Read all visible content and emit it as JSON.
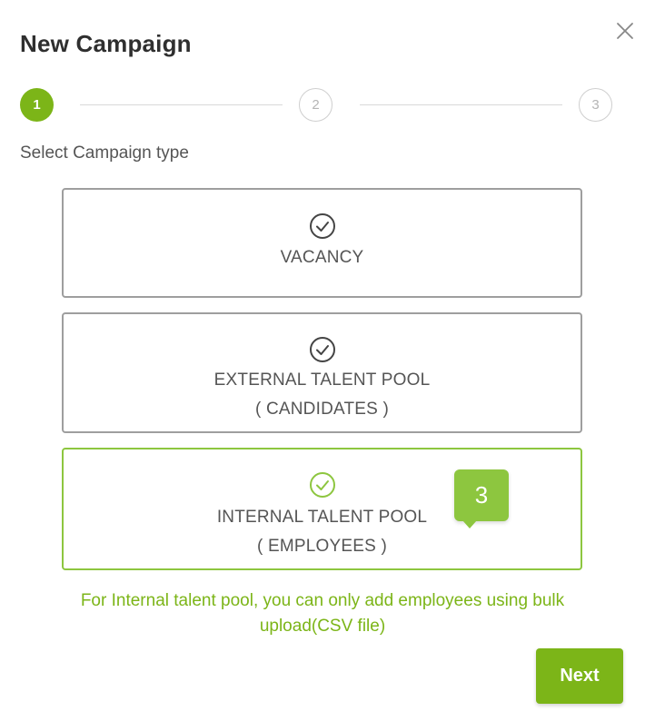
{
  "dialog": {
    "title": "New Campaign",
    "close_icon": "close-icon"
  },
  "stepper": {
    "steps": [
      {
        "label": "1",
        "state": "active"
      },
      {
        "label": "2",
        "state": "inactive"
      },
      {
        "label": "3",
        "state": "inactive"
      }
    ]
  },
  "subtitle": "Select Campaign type",
  "campaign_types": [
    {
      "line1": "VACANCY",
      "line2": "",
      "icon": "check-circle-icon",
      "selected": false
    },
    {
      "line1": "EXTERNAL TALENT POOL",
      "line2": "( CANDIDATES )",
      "icon": "check-circle-icon",
      "selected": false
    },
    {
      "line1": "INTERNAL TALENT POOL",
      "line2": "( EMPLOYEES )",
      "icon": "check-circle-icon",
      "selected": true
    }
  ],
  "badge": {
    "label": "3"
  },
  "note": "For Internal talent pool, you can only add employees using bulk upload(CSV file)",
  "next_button": {
    "label": "Next"
  },
  "colors": {
    "accent": "#7cb518",
    "selected_border": "#8dc63f",
    "card_border": "#9e9e9e",
    "text": "#555555"
  }
}
